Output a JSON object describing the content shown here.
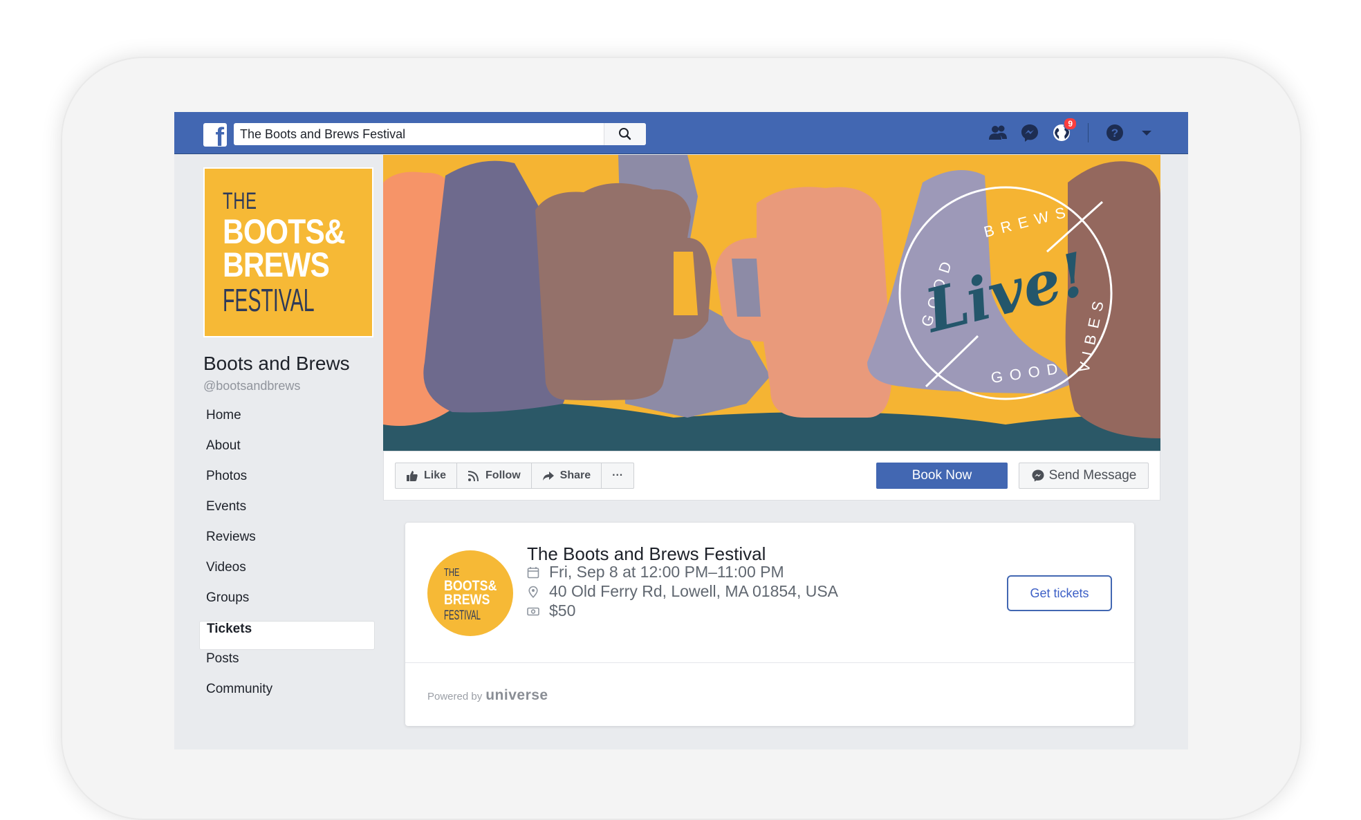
{
  "topbar": {
    "search_value": "The Boots and Brews Festival",
    "notification_count": "9"
  },
  "profile": {
    "logo_the": "THE",
    "logo_boots": "BOOTS&",
    "logo_brews": "BREWS",
    "logo_festival": "FESTIVAL",
    "name": "Boots and Brews",
    "handle": "@bootsandbrews"
  },
  "sidebar": {
    "items": [
      {
        "label": "Home"
      },
      {
        "label": "About"
      },
      {
        "label": "Photos"
      },
      {
        "label": "Events"
      },
      {
        "label": "Reviews"
      },
      {
        "label": "Videos"
      },
      {
        "label": "Groups"
      },
      {
        "label": "Tickets"
      },
      {
        "label": "Posts"
      },
      {
        "label": "Community"
      }
    ],
    "active": "Tickets"
  },
  "cover": {
    "badge_top": "BREWS",
    "badge_left": "GOOD",
    "badge_center": "Live!",
    "badge_right": "VIBES",
    "badge_bottom": "GOOD"
  },
  "actions": {
    "like": "Like",
    "follow": "Follow",
    "share": "Share",
    "more": "···",
    "book_now": "Book Now",
    "send_message": "Send Message"
  },
  "ticket": {
    "title": "The Boots and Brews Festival",
    "datetime": "Fri, Sep 8 at 12:00 PM–11:00 PM",
    "location": "40 Old Ferry Rd, Lowell, MA 01854, USA",
    "price": "$50",
    "cta": "Get tickets",
    "powered_by": "Powered by",
    "provider": "universe"
  },
  "colors": {
    "facebook_blue": "#4267b2",
    "brand_yellow": "#f6b936",
    "brand_navy": "#2e3a59"
  }
}
